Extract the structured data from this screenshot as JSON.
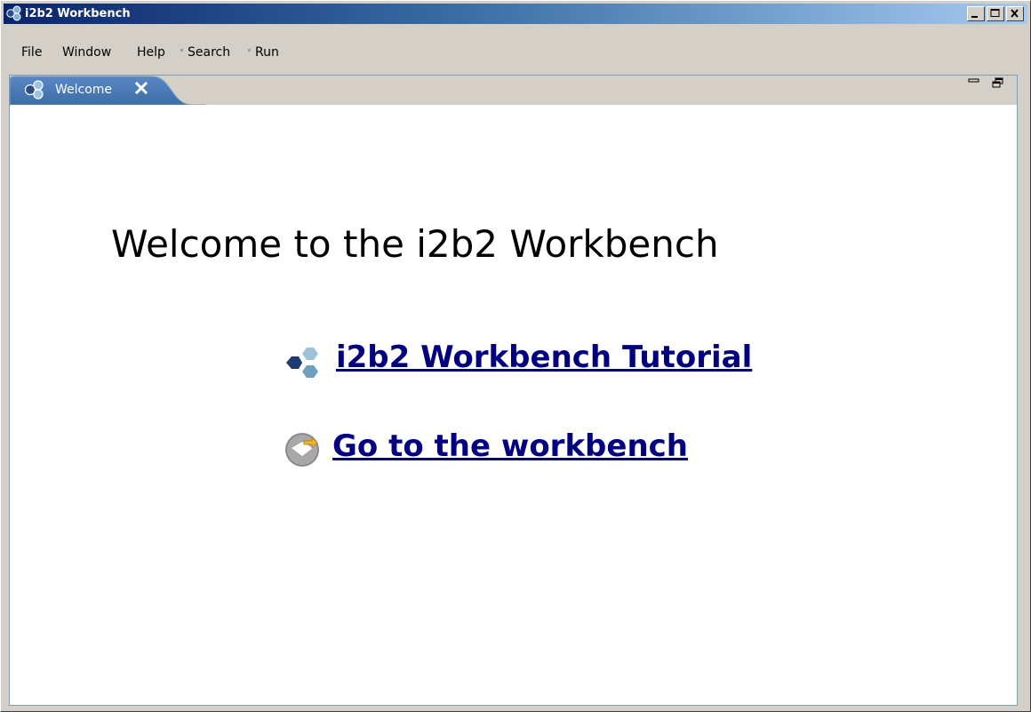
{
  "window": {
    "title": "i2b2 Workbench",
    "controls": {
      "minimize_icon": "minimize-icon",
      "maximize_icon": "maximize-icon",
      "close_icon": "close-icon"
    }
  },
  "menu": {
    "items": [
      {
        "label": "File"
      },
      {
        "label": "Window"
      },
      {
        "label": "Help"
      },
      {
        "label": "Search"
      },
      {
        "label": "Run"
      }
    ]
  },
  "tabs": [
    {
      "label": "Welcome",
      "icon": "i2b2-molecule-icon",
      "active": true
    }
  ],
  "view_controls": {
    "minimize": "view-minimize-icon",
    "restore": "view-restore-icon"
  },
  "welcome": {
    "title": "Welcome to the i2b2 Workbench",
    "links": [
      {
        "label": "i2b2 Workbench Tutorial",
        "icon": "molecule-icon"
      },
      {
        "label": "Go to the workbench",
        "icon": "workbench-icon"
      }
    ]
  },
  "colors": {
    "titlebar_start": "#0a246a",
    "titlebar_end": "#a6caf0",
    "link": "#000080",
    "tab_active": "#3a6ea5",
    "panel_border": "#7f9db9"
  }
}
